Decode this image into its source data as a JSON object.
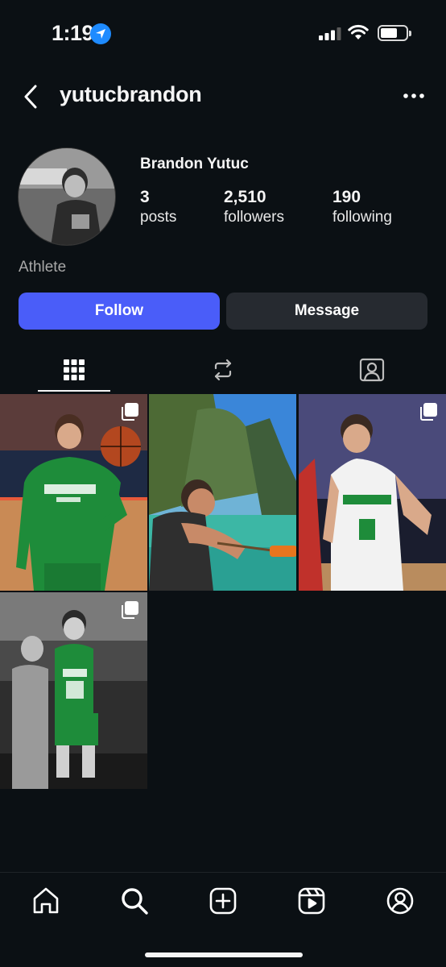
{
  "status_bar": {
    "time": "1:19"
  },
  "header": {
    "username": "yutucbrandon"
  },
  "profile": {
    "display_name": "Brandon Yutuc",
    "stats": [
      {
        "value": "3",
        "label": "posts"
      },
      {
        "value": "2,510",
        "label": "followers"
      },
      {
        "value": "190",
        "label": "following"
      }
    ],
    "bio": "Athlete"
  },
  "actions": {
    "follow_label": "Follow",
    "message_label": "Message"
  },
  "tabs": [
    {
      "icon": "grid-icon",
      "active": true
    },
    {
      "icon": "reels-repost-icon",
      "active": false
    },
    {
      "icon": "tagged-icon",
      "active": false
    }
  ],
  "posts": [
    {
      "type": "carousel"
    },
    {
      "type": "single"
    },
    {
      "type": "carousel"
    },
    {
      "type": "carousel"
    }
  ],
  "bottom_nav": [
    "home-icon",
    "search-icon",
    "create-icon",
    "reels-icon",
    "profile-icon"
  ],
  "colors": {
    "background": "#0b1014",
    "accent": "#4a5df9",
    "secondary_button": "#262a30"
  }
}
